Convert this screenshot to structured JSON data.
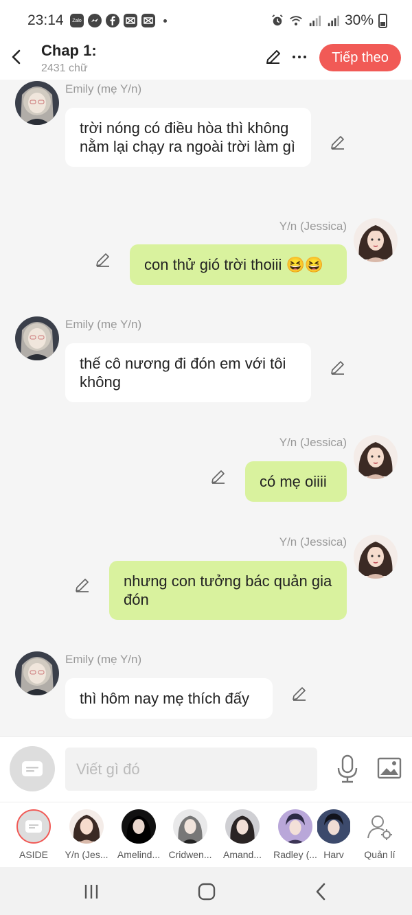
{
  "status": {
    "time": "23:14",
    "battery": "30%",
    "app_icons": [
      "zalo-icon",
      "messenger-icon",
      "facebook-icon",
      "capcut-icon",
      "capcut-icon"
    ]
  },
  "header": {
    "title": "Chap 1:",
    "word_count": "2431 chữ",
    "next_label": "Tiếp theo"
  },
  "messages": [
    {
      "side": "left",
      "name": "Emily (mẹ Y/n)",
      "text": "trời nóng có điều hòa thì không nằm lại chạy ra ngoài trời làm gì"
    },
    {
      "side": "right",
      "name": "Y/n (Jessica)",
      "text": "con thử gió trời thoiii 😆😆"
    },
    {
      "side": "left",
      "name": "Emily (mẹ Y/n)",
      "text": "thế cô nương đi đón em với tôi không"
    },
    {
      "side": "right",
      "name": "Y/n (Jessica)",
      "text": "có mẹ oiiii"
    },
    {
      "side": "right",
      "name": "Y/n (Jessica)",
      "text": "nhưng con tưởng bác quản gia đón"
    },
    {
      "side": "left",
      "name": "Emily (mẹ Y/n)",
      "text": "thì hôm nay mẹ thích đấy"
    }
  ],
  "composer": {
    "placeholder": "Viết gì đó"
  },
  "characters": [
    {
      "label": "ASIDE"
    },
    {
      "label": "Y/n (Jes..."
    },
    {
      "label": "Amelind..."
    },
    {
      "label": "Cridwen..."
    },
    {
      "label": "Amand..."
    },
    {
      "label": "Radley (..."
    },
    {
      "label": "Harv"
    },
    {
      "label": "Quản lí"
    }
  ],
  "colors": {
    "accent": "#f15a56",
    "bubble_right": "#d9f29e",
    "bubble_left": "#ffffff",
    "background": "#f5f5f5"
  }
}
